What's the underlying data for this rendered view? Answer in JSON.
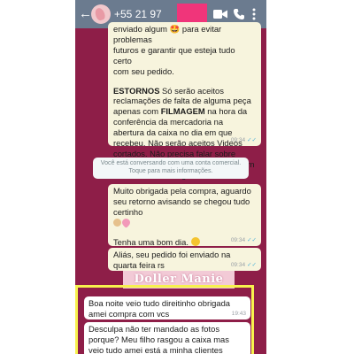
{
  "header": {
    "phone_number": "+55 21 97",
    "icons": [
      "back-arrow-icon",
      "video-call-icon",
      "phone-call-icon",
      "more-options-icon"
    ]
  },
  "messages": [
    {
      "id": "m1",
      "direction": "outgoing",
      "lines": [
        "enviado algum 🤩 para evitar problemas",
        "futuros e garantir que esteja tudo certo",
        "com seu pedido."
      ],
      "para2": "ESTORNOS  Só serão aceitos reclamações de falta de alguma peça apenas com FILMAGEM na hora da conferência da mercadoria na abertura da caixa no dia em que recebeu. Não serão aceitos Videos cortados. Não precisa falar sobre cada peça, somente fazer a contagem e confirmar se chegou tudo ok.",
      "para2_parts": {
        "bold1": "ESTORNOS",
        "text1": "  Só serão aceitos reclamações de falta de alguma peça apenas com ",
        "bold2": "FILMAGEM",
        "text2": " na hora da conferência da mercadoria na abertura da caixa no dia em que recebeu. Não serão aceitos Videos cortados. Não precisa falar sobre cada peça, somente fazer a contagem e confirmar se chegou tudo ok."
      },
      "time": "09:34"
    },
    {
      "id": "system",
      "text": "Você está conversando com uma conta comercial. Toque para mais informações."
    },
    {
      "id": "m2",
      "direction": "outgoing",
      "text1": "Muito obrigada pela compra, aguardo seu retorno avisando se chegou tudo certinho",
      "text2": "Tenha uma bom dia.",
      "time": "09:34"
    },
    {
      "id": "m3",
      "direction": "outgoing",
      "text": "Aliás, seu pedido foi enviado na quarta feira rs",
      "time": "09:34"
    },
    {
      "id": "m4",
      "direction": "incoming",
      "text": "Boa noite veio tudo direitinho obrigada amei compra com vcs",
      "time": "19:43"
    },
    {
      "id": "m5",
      "direction": "incoming",
      "text": "Desculpa não ter mandado as fotos porque? Meu filho rasgou a caixa mas veio tudo amei está a minha clientes"
    }
  ],
  "watermark": "Doller Manie",
  "colors": {
    "chat_bg": "#8e1e48",
    "appbar": "#6b7b8f",
    "outgoing_bubble": "#f7f4dd",
    "incoming_bubble": "#ffffff",
    "highlight_border": "#f7f14d",
    "redaction": "#f0357a"
  }
}
